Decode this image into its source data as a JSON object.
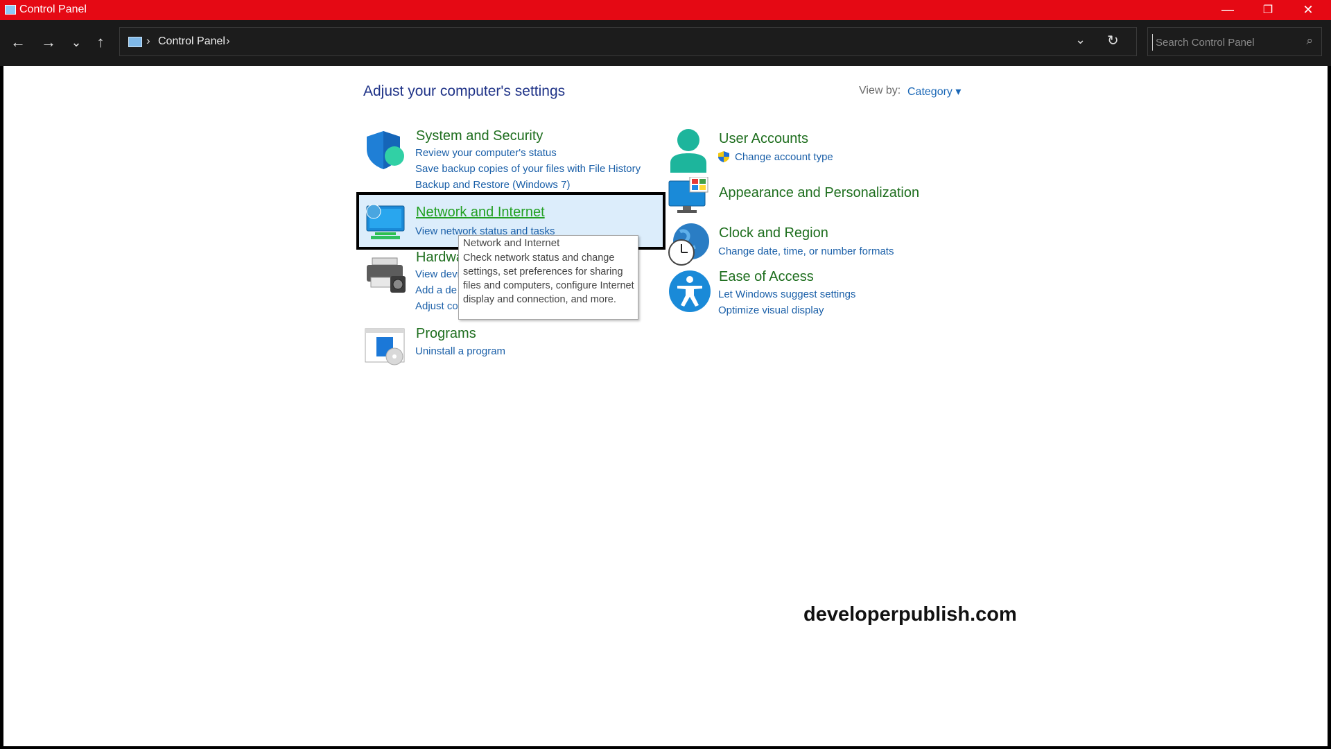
{
  "window": {
    "title": "Control Panel",
    "accent": "#e50914"
  },
  "titlebar": {
    "minimize": "—",
    "restore": "❐",
    "close": "✕"
  },
  "nav": {
    "back": "←",
    "forward": "→",
    "recent": "⌄",
    "up": "↑"
  },
  "address": {
    "breadcrumb": "Control Panel",
    "sep": "›",
    "dropdown": "⌄",
    "refresh": "↻"
  },
  "search": {
    "placeholder": "Search Control Panel",
    "icon": "⌕"
  },
  "main": {
    "heading": "Adjust your computer's settings",
    "view_by_label": "View by:",
    "view_by_value": "Category ▾"
  },
  "categories": {
    "system_security": {
      "title": "System and Security",
      "links": [
        "Review your computer's status",
        "Save backup copies of your files with File History",
        "Backup and Restore (Windows 7)"
      ]
    },
    "network": {
      "title": "Network and Internet",
      "links": [
        "View network status and tasks"
      ]
    },
    "hardware": {
      "title": "Hardwa",
      "links": [
        "View devi",
        "Add a de",
        "Adjust co"
      ]
    },
    "programs": {
      "title": "Programs",
      "links": [
        "Uninstall a program"
      ]
    },
    "user_accounts": {
      "title": "User Accounts",
      "links": [
        "Change account type"
      ]
    },
    "appearance": {
      "title": "Appearance and Personalization"
    },
    "clock": {
      "title": "Clock and Region",
      "links": [
        "Change date, time, or number formats"
      ]
    },
    "ease": {
      "title": "Ease of Access",
      "links": [
        "Let Windows suggest settings",
        "Optimize visual display"
      ]
    }
  },
  "tooltip": {
    "title": "Network and Internet",
    "body": "Check network status and change settings, set preferences for sharing files and computers, configure Internet display and connection, and more."
  },
  "watermark": "developerpublish.com"
}
